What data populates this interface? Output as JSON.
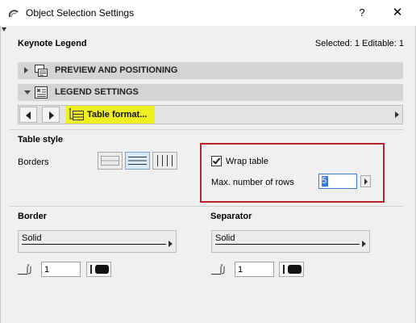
{
  "window": {
    "title": "Object Selection Settings",
    "help_label": "?",
    "close_label": "✕"
  },
  "header": {
    "element_name": "Keynote Legend",
    "selection_info": "Selected: 1 Editable: 1"
  },
  "panels": [
    {
      "label": "PREVIEW AND POSITIONING",
      "expanded": false,
      "icon": "preview-positioning-icon"
    },
    {
      "label": "LEGEND SETTINGS",
      "expanded": true,
      "icon": "legend-settings-icon"
    }
  ],
  "page_nav": {
    "current_page": "Table format...",
    "highlight_color": "#f0f020"
  },
  "table_style": {
    "heading": "Table style",
    "borders_label": "Borders",
    "border_options": [
      "all-borders-icon",
      "horizontal-borders-icon",
      "vertical-borders-icon"
    ],
    "selected_border_option": "horizontal-borders-icon",
    "wrap_table_label": "Wrap table",
    "wrap_table_checked": true,
    "max_rows_label": "Max. number of rows",
    "max_rows_value": "5",
    "highlight_box_color": "#b5252a"
  },
  "border": {
    "heading": "Border",
    "line_type": "Solid",
    "pen_value": "1"
  },
  "separator": {
    "heading": "Separator",
    "line_type": "Solid",
    "pen_value": "1"
  }
}
